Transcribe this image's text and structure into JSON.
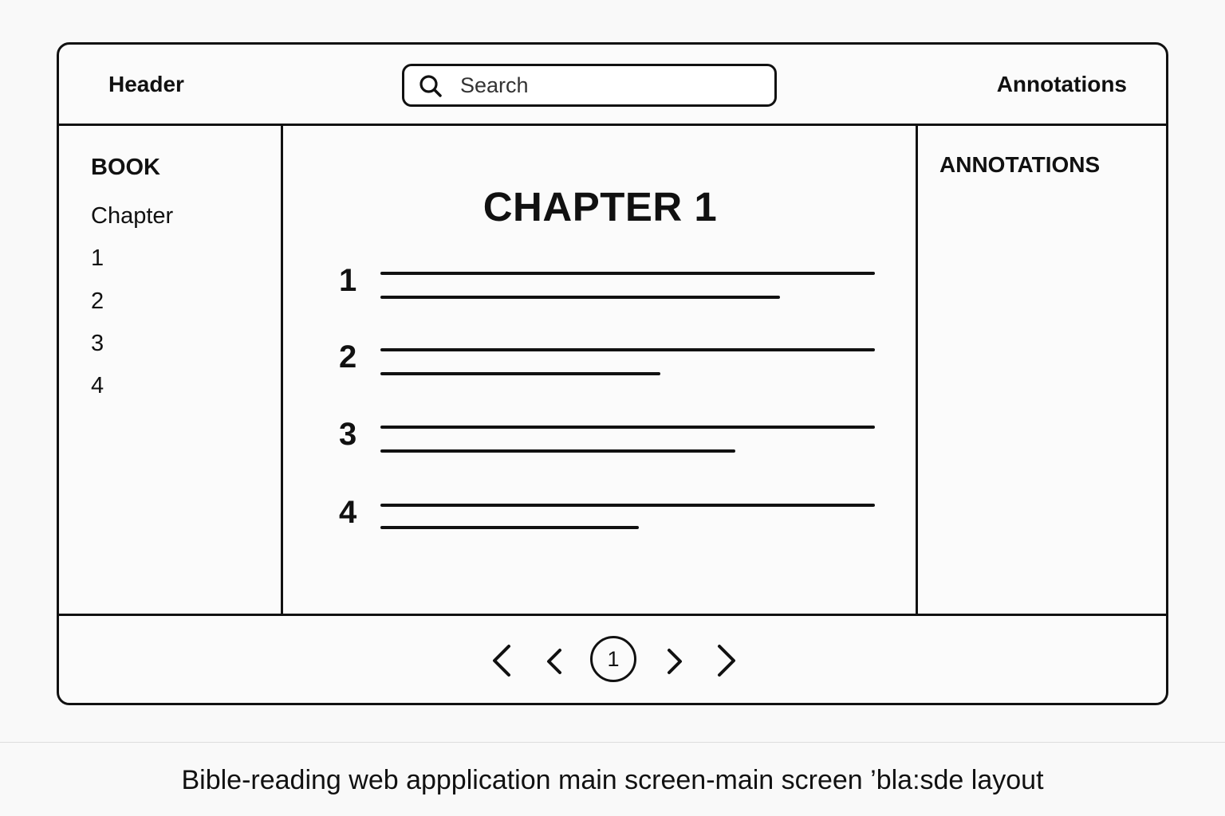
{
  "header": {
    "title": "Header",
    "search_placeholder": "Search",
    "annotations_label": "Annotations"
  },
  "sidebar": {
    "book_label": "BOOK",
    "chapter_label": "Chapter",
    "chapters": [
      "1",
      "2",
      "3",
      "4"
    ]
  },
  "main": {
    "chapter_title": "CHAPTER 1",
    "verses": [
      {
        "number": "1"
      },
      {
        "number": "2"
      },
      {
        "number": "3"
      },
      {
        "number": "4"
      }
    ]
  },
  "annotations_panel": {
    "title": "ANNOTATIONS"
  },
  "pagination": {
    "current_page": "1",
    "icons": [
      "first-page-icon",
      "prev-page-icon",
      "next-page-icon",
      "last-page-icon"
    ]
  },
  "caption": "Bible-reading web appplication  main screen-main screen ’bla:sde layout",
  "colors": {
    "line": "#111111",
    "background": "#f9f9f9"
  }
}
